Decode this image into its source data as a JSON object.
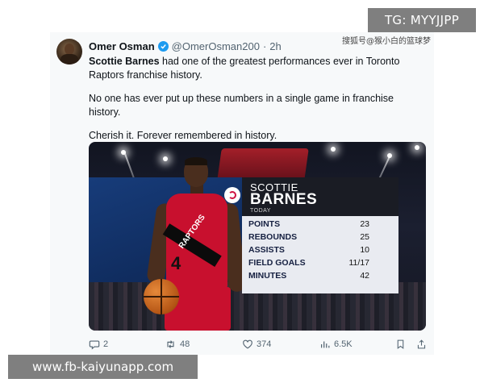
{
  "overlays": {
    "tg_label": "TG: MYYJJPP",
    "top_watermark": "搜狐号@猴小白的篮球梦",
    "site_url": "www.fb-kaiyunapp.com"
  },
  "tweet": {
    "display_name": "Omer Osman",
    "handle": "@OmerOsman200",
    "separator": "·",
    "time": "2h",
    "line1_bold": "Scottie Barnes",
    "line1_rest": " had one of the greatest performances ever in Toronto Raptors franchise history.",
    "line2": "No one has ever put up these numbers in a single game in franchise history.",
    "line3": "Cherish it. Forever remembered in history."
  },
  "stat_card": {
    "first_name": "SCOTTIE",
    "last_name": "BARNES",
    "subtitle": "TODAY",
    "rows": [
      {
        "label": "POINTS",
        "value": "23"
      },
      {
        "label": "REBOUNDS",
        "value": "25"
      },
      {
        "label": "ASSISTS",
        "value": "10"
      },
      {
        "label": "FIELD GOALS",
        "value": "11/17"
      },
      {
        "label": "MINUTES",
        "value": "42"
      }
    ],
    "jersey_number": "4",
    "jersey_word": "RAPTORS"
  },
  "actions": {
    "replies": "2",
    "reposts": "48",
    "likes": "374",
    "views": "6.5K"
  },
  "colors": {
    "verified": "#1d9bf0",
    "raptors_red": "#c8102e",
    "card_blue": "#162041"
  }
}
